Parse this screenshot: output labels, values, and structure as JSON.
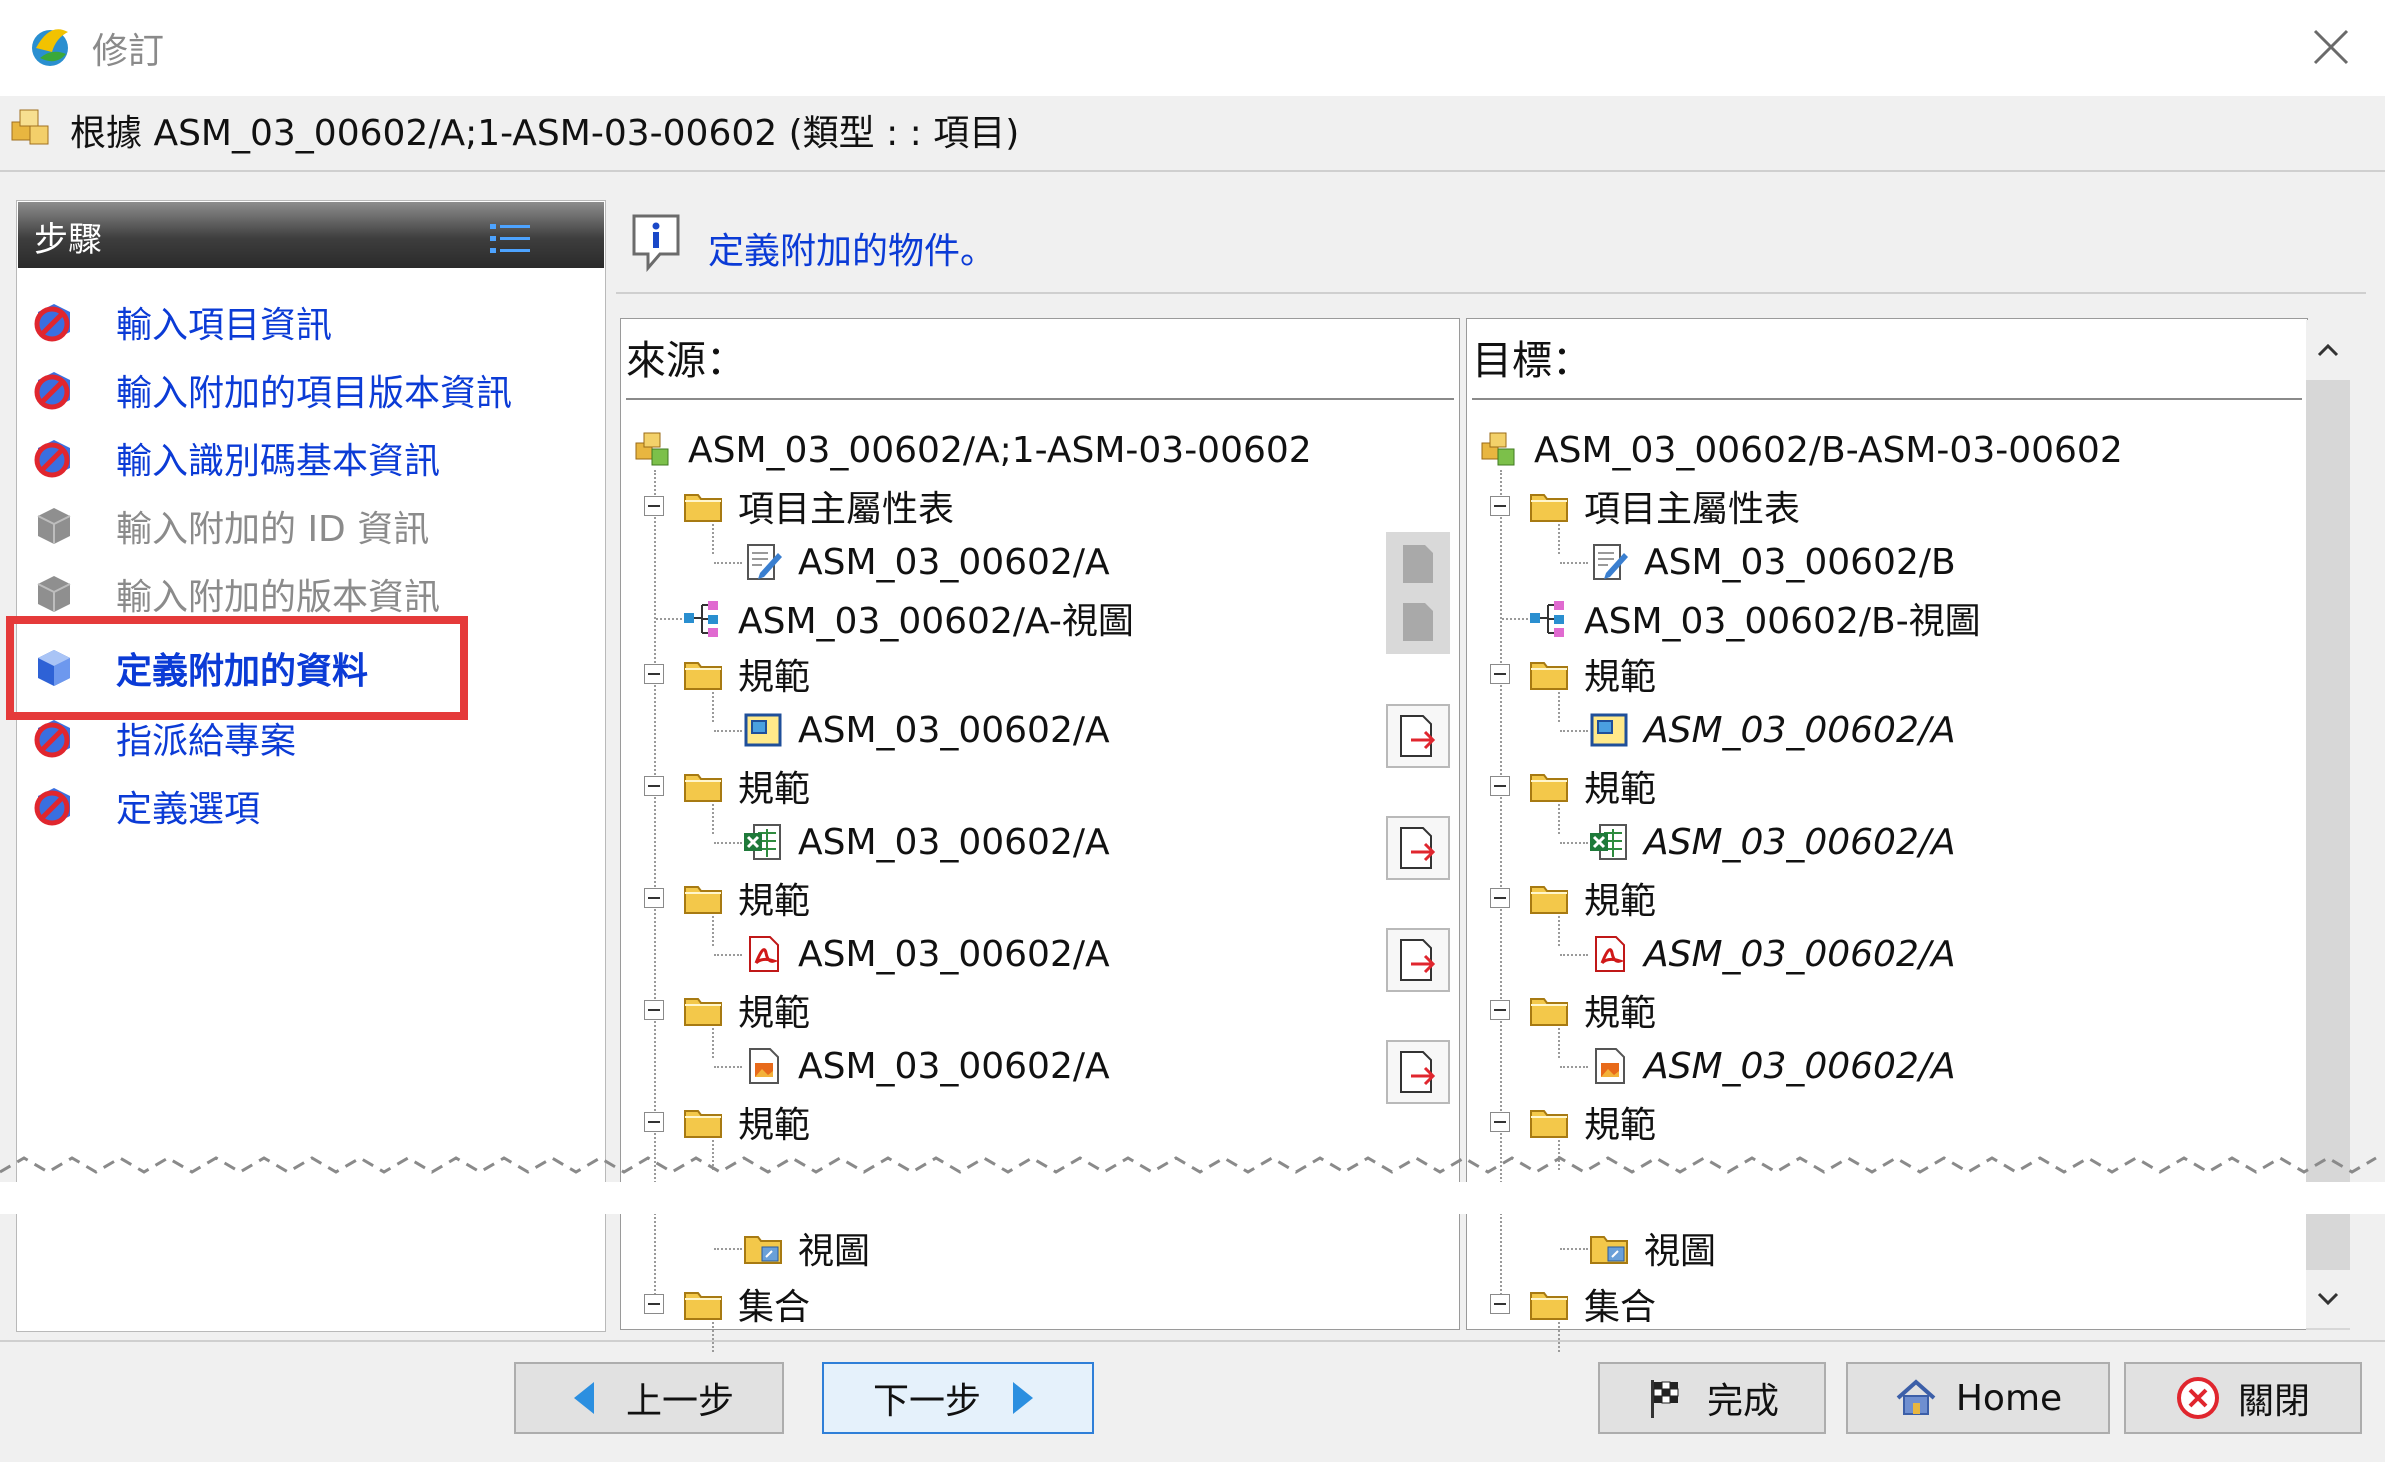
{
  "window": {
    "title": "修訂",
    "close_icon": "close-icon"
  },
  "subtitle": "根據 ASM_03_00602/A;1-ASM-03-00602 (類型 : : 項目)",
  "steps": {
    "title": "步驟",
    "items": [
      {
        "label": "輸入項目資訊",
        "state": "done"
      },
      {
        "label": "輸入附加的項目版本資訊",
        "state": "done"
      },
      {
        "label": "輸入識別碼基本資訊",
        "state": "done"
      },
      {
        "label": "輸入附加的 ID 資訊",
        "state": "disabled"
      },
      {
        "label": "輸入附加的版本資訊",
        "state": "disabled"
      },
      {
        "label": "定義附加的資料",
        "state": "active"
      },
      {
        "label": "指派給專案",
        "state": "done"
      },
      {
        "label": "定義選項",
        "state": "done"
      }
    ]
  },
  "info": {
    "text": "定義附加的物件。"
  },
  "source": {
    "header": "來源：",
    "root": "ASM_03_00602/A;1-ASM-03-00602",
    "rows": [
      "項目主屬性表",
      "ASM_03_00602/A",
      "ASM_03_00602/A-視圖",
      "規範",
      "ASM_03_00602/A",
      "規範",
      "ASM_03_00602/A",
      "規範",
      "ASM_03_00602/A",
      "規範",
      "ASM_03_00602/A",
      "規範",
      "視圖",
      "集合"
    ]
  },
  "target": {
    "header": "目標：",
    "root": "ASM_03_00602/B-ASM-03-00602",
    "rows": [
      "項目主屬性表",
      "ASM_03_00602/B",
      "ASM_03_00602/B-視圖",
      "規範",
      "ASM_03_00602/A",
      "規範",
      "ASM_03_00602/A",
      "規範",
      "ASM_03_00602/A",
      "規範",
      "ASM_03_00602/A",
      "規範",
      "視圖",
      "集合"
    ]
  },
  "buttons": {
    "back": "上一步",
    "next": "下一步",
    "finish": "完成",
    "home": "Home",
    "close": "關閉"
  },
  "colors": {
    "link_blue": "#0b3bd6",
    "highlight_red": "#e53a3a",
    "next_button_border": "#2f7fd8"
  }
}
